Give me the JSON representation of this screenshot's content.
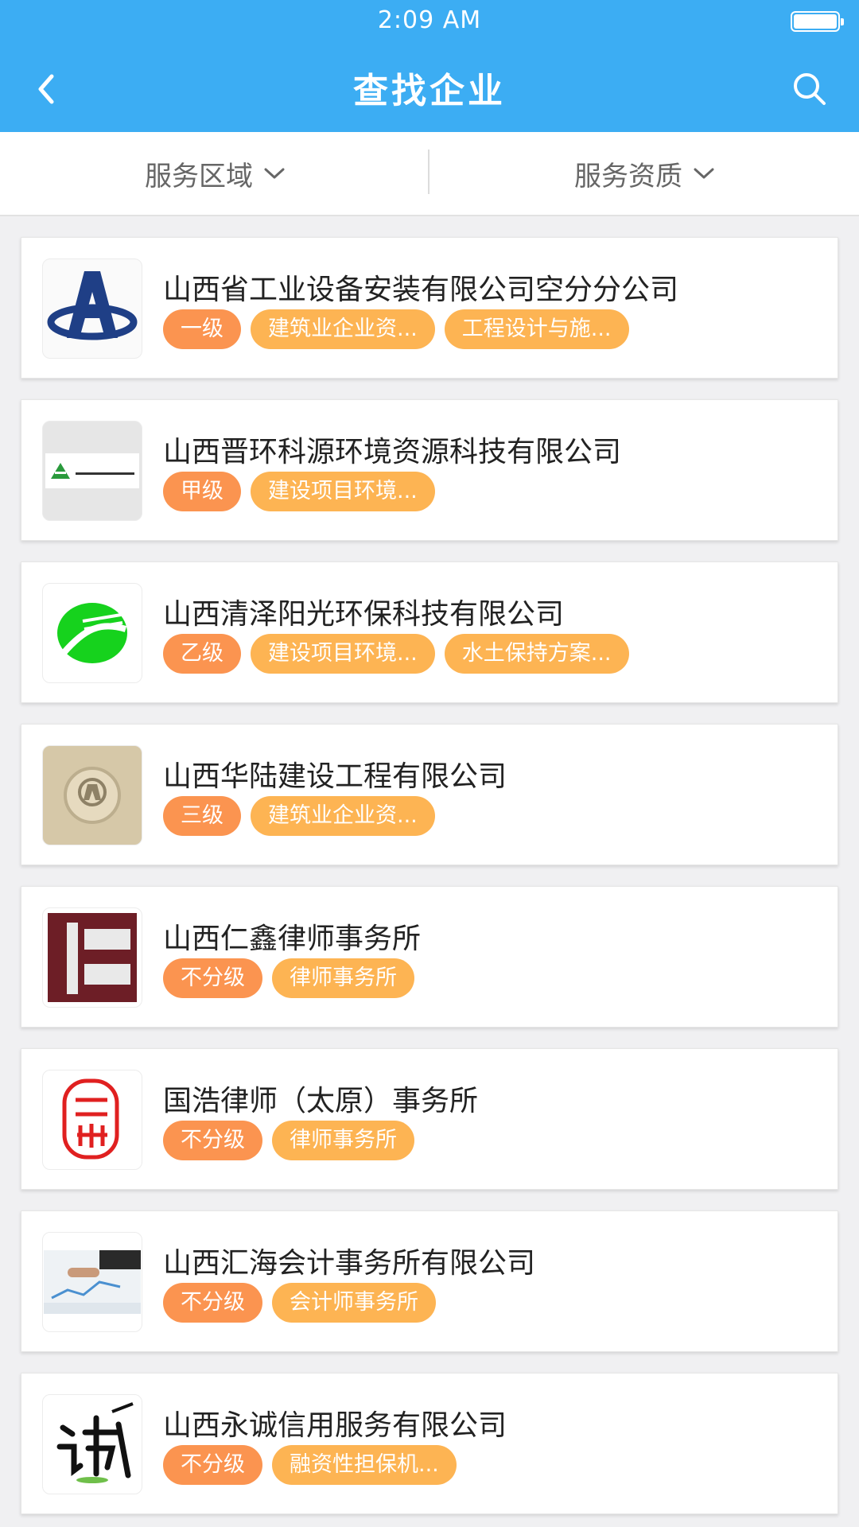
{
  "status_bar": {
    "time": "2:09 AM"
  },
  "header": {
    "title": "查找企业",
    "back_icon": "chevron-left-icon",
    "search_icon": "search-icon"
  },
  "filters": [
    {
      "label": "服务区域"
    },
    {
      "label": "服务资质"
    }
  ],
  "colors": {
    "header_bg": "#3cadf3",
    "level_tag": "#fb9450",
    "type_tag": "#fdb453"
  },
  "companies": [
    {
      "name": "山西省工业设备安装有限公司空分分公司",
      "level": "一级",
      "tags": [
        "建筑业企业资...",
        "工程设计与施..."
      ],
      "logo": "letter-a-blue-logo"
    },
    {
      "name": "山西晋环科源环境资源科技有限公司",
      "level": "甲级",
      "tags": [
        "建设项目环境..."
      ],
      "logo": "jinhuan-keyuan-logo"
    },
    {
      "name": "山西清泽阳光环保科技有限公司",
      "level": "乙级",
      "tags": [
        "建设项目环境...",
        "水土保持方案..."
      ],
      "logo": "green-leaf-logo"
    },
    {
      "name": "山西华陆建设工程有限公司",
      "level": "三级",
      "tags": [
        "建筑业企业资..."
      ],
      "logo": "beige-emblem-logo"
    },
    {
      "name": "山西仁鑫律师事务所",
      "level": "不分级",
      "tags": [
        "律师事务所"
      ],
      "logo": "red-frame-logo"
    },
    {
      "name": "国浩律师（太原）事务所",
      "level": "不分级",
      "tags": [
        "律师事务所"
      ],
      "logo": "red-seal-logo"
    },
    {
      "name": "山西汇海会计事务所有限公司",
      "level": "不分级",
      "tags": [
        "会计师事务所"
      ],
      "logo": "business-photo-logo"
    },
    {
      "name": "山西永诚信用服务有限公司",
      "level": "不分级",
      "tags": [
        "融资性担保机..."
      ],
      "logo": "calligraphy-logo"
    }
  ]
}
